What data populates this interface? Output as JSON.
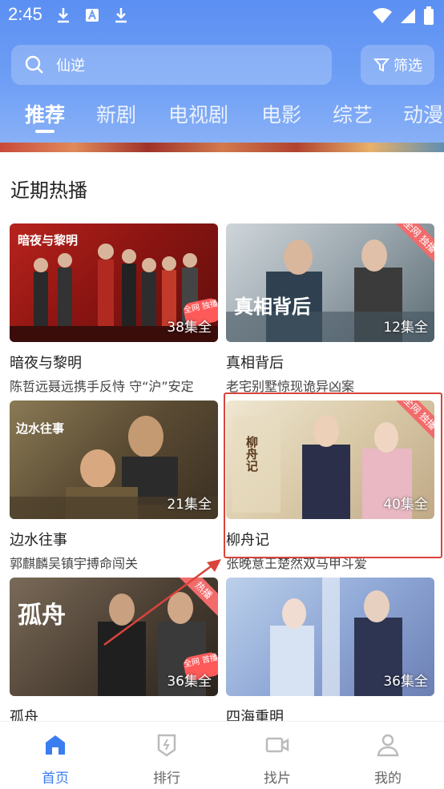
{
  "status_bar": {
    "time": "2:45"
  },
  "search": {
    "text": "仙逆"
  },
  "filter": {
    "label": "筛选"
  },
  "tabs": [
    {
      "label": "推荐",
      "active": true
    },
    {
      "label": "新剧"
    },
    {
      "label": "电视剧"
    },
    {
      "label": "电影"
    },
    {
      "label": "综艺"
    },
    {
      "label": "动漫"
    }
  ],
  "section": {
    "title": "近期热播"
  },
  "cards": [
    {
      "title": "暗夜与黎明",
      "subtitle": "陈哲远聂远携手反恃 守“沪”安定",
      "episodes": "38集全",
      "poster_text": "暗夜与黎明",
      "badge": "全网 独播"
    },
    {
      "title": "真相背后",
      "subtitle": "老宅别墅惊现诡异凶案",
      "episodes": "12集全",
      "poster_text": "真相背后",
      "tag": "全网 独播"
    },
    {
      "title": "边水往事",
      "subtitle": "郭麒麟吴镇宇搏命闯关",
      "episodes": "21集全",
      "poster_text": "边水往事"
    },
    {
      "title": "柳舟记",
      "subtitle": "张晚意王楚然双马甲斗爱",
      "episodes": "40集全",
      "poster_text": "柳舟记",
      "tag": "全网 独播"
    },
    {
      "title": "孤舟",
      "subtitle": "",
      "episodes": "36集全",
      "poster_text": "孤舟",
      "tag": "热播",
      "badge": "全网 首播"
    },
    {
      "title": "四海重明",
      "subtitle": "",
      "episodes": "36集全"
    }
  ],
  "bottom_nav": [
    {
      "label": "首页",
      "icon": "home-icon",
      "active": true
    },
    {
      "label": "排行",
      "icon": "ranking-icon"
    },
    {
      "label": "找片",
      "icon": "video-camera-icon"
    },
    {
      "label": "我的",
      "icon": "user-icon"
    }
  ],
  "colors": {
    "accent": "#3a7df0",
    "header": "#6f9ff5",
    "highlight": "#d9443b"
  }
}
